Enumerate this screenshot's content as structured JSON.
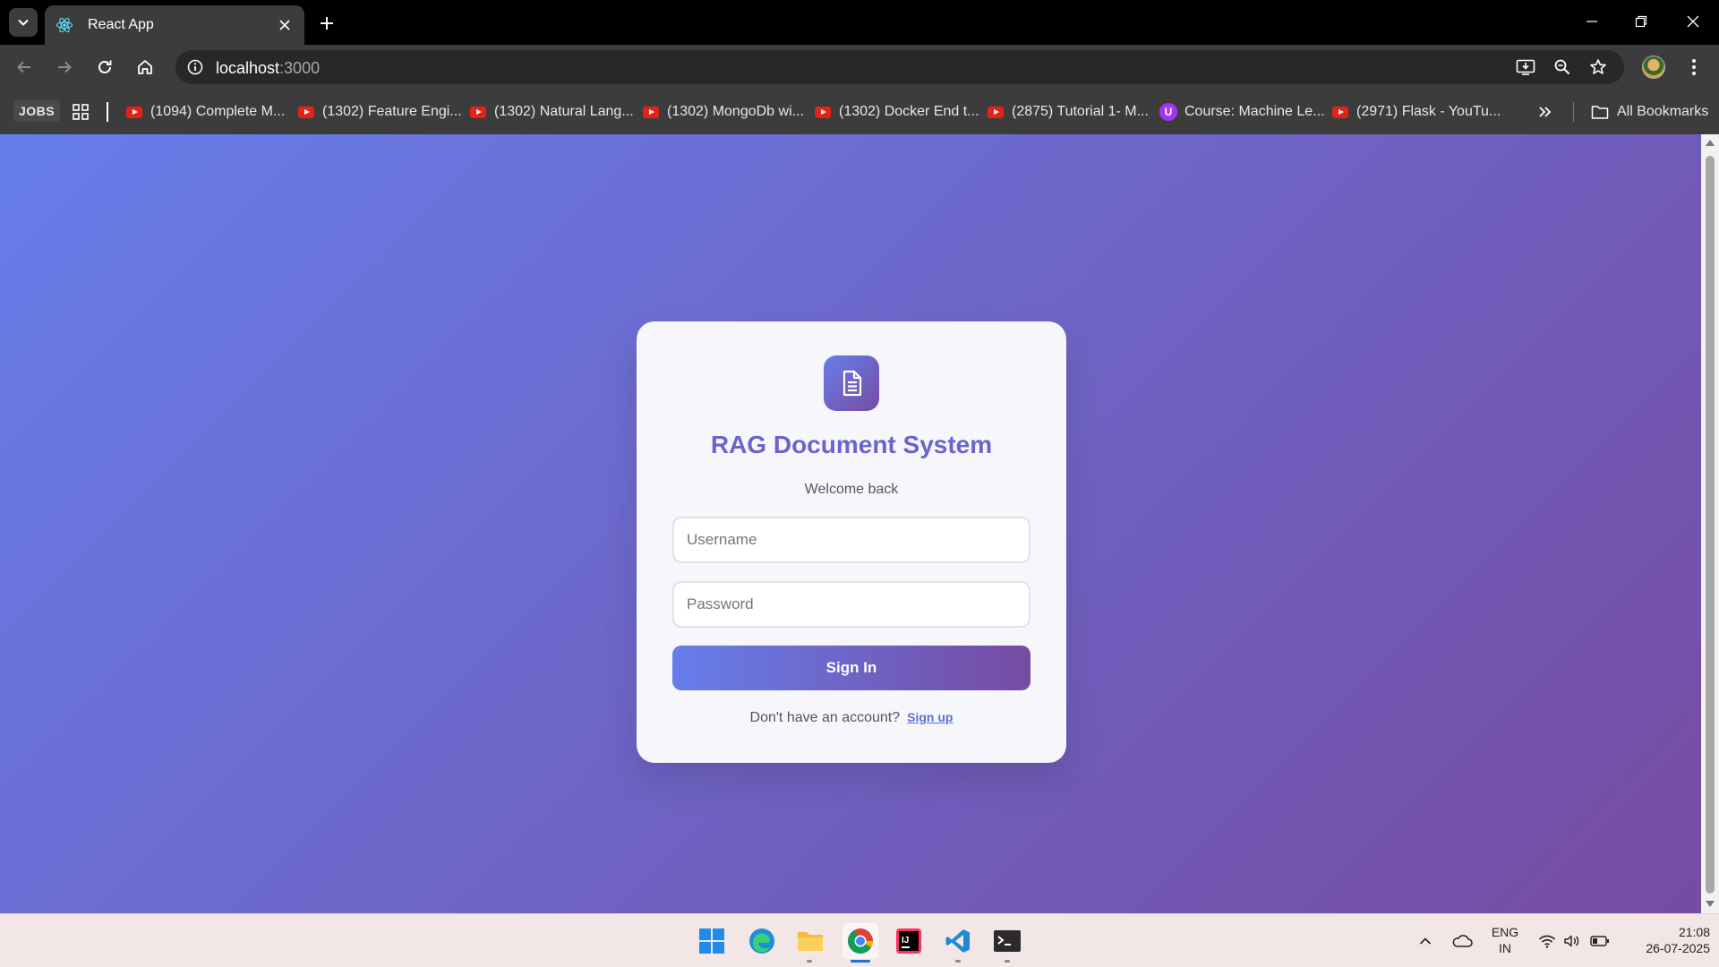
{
  "browser": {
    "tab_title": "React App",
    "url_host": "localhost",
    "url_port": ":3000"
  },
  "bookmarks": {
    "jobs_label": "JOBS",
    "items": [
      {
        "label": "(1094) Complete M...",
        "icon": "youtube-icon"
      },
      {
        "label": "(1302) Feature Engi...",
        "icon": "youtube-icon"
      },
      {
        "label": "(1302) Natural Lang...",
        "icon": "youtube-icon"
      },
      {
        "label": "(1302) MongoDb wi...",
        "icon": "youtube-icon"
      },
      {
        "label": "(1302) Docker End t...",
        "icon": "youtube-icon"
      },
      {
        "label": "(2875) Tutorial 1- M...",
        "icon": "youtube-icon"
      },
      {
        "label": "Course: Machine Le...",
        "icon": "udemy-icon"
      },
      {
        "label": "(2971) Flask - YouTu...",
        "icon": "youtube-icon"
      }
    ],
    "all_bookmarks_label": "All Bookmarks"
  },
  "login": {
    "title": "RAG Document System",
    "subtitle": "Welcome back",
    "username_placeholder": "Username",
    "password_placeholder": "Password",
    "submit_label": "Sign In",
    "switch_prompt": "Don't have an account?",
    "switch_link": "Sign up"
  },
  "taskbar": {
    "language": "ENG",
    "region": "IN",
    "time": "21:08",
    "date": "26-07-2025"
  },
  "colors": {
    "gradient_start": "#667eea",
    "gradient_end": "#764ba2",
    "title_color": "#6a64cc"
  }
}
